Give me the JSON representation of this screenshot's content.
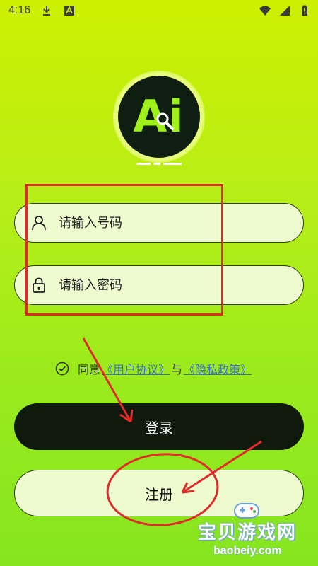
{
  "status_bar": {
    "time": "4:16",
    "icons": [
      "download-icon",
      "a-icon",
      "wifi-icon",
      "signal-icon",
      "battery-icon"
    ]
  },
  "logo": {
    "text": "Ai",
    "colors": {
      "ring": "#e8fb7c",
      "inner": "#0e1f12",
      "letters": "#9ef21a"
    }
  },
  "form": {
    "phone": {
      "placeholder": "请输入号码",
      "icon": "user-icon"
    },
    "password": {
      "placeholder": "请输入密码",
      "icon": "lock-icon"
    }
  },
  "agreement": {
    "prefix": "同意",
    "user_agreement": "《用户协议》",
    "joiner": "与",
    "privacy_policy": "《隐私政策》",
    "checked_icon": "check-circle-icon"
  },
  "buttons": {
    "login": "登录",
    "register": "注册"
  },
  "watermark": {
    "title": "宝贝游戏网",
    "url": "baobeiy.com"
  },
  "colors": {
    "background_top": "#cdf000",
    "background_bottom": "#86e51f",
    "login_button": "#101a0c",
    "input_bg": "#eefbcf",
    "link": "#3a6fd1",
    "annotation": "#e12a2a"
  }
}
